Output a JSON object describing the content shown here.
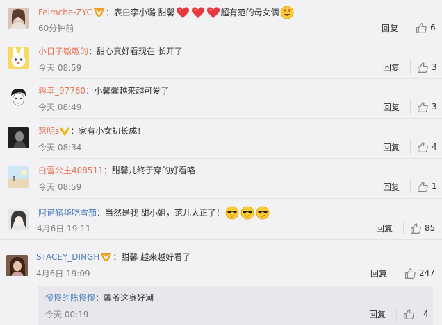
{
  "comments": [
    {
      "user": "Feimche-ZYC",
      "text_parts": [
        "：表白李小璐 甜馨",
        "超有范的母女俩"
      ],
      "time": "60分钟前",
      "reply": "回复",
      "likes": "6",
      "avatar": "avatar-photo-girl"
    },
    {
      "user": "小日子嗷嗷的",
      "text_parts": [
        "：甜心真好看现在 长开了"
      ],
      "time": "今天 08:59",
      "reply": "回复",
      "likes": "3",
      "avatar": "avatar-bunny-cartoon"
    },
    {
      "user": "蓉幸_97760",
      "text_parts": [
        "：小馨馨越来越可爱了"
      ],
      "time": "今天 08:49",
      "reply": "回复",
      "likes": "3",
      "avatar": "avatar-sketch-face"
    },
    {
      "user": "慧明s",
      "text_parts": [
        "：家有小女初长成！"
      ],
      "time": "今天 08:34",
      "reply": "回复",
      "likes": "4",
      "avatar": "avatar-dark-portrait"
    },
    {
      "user": "白雪公主408511",
      "text_parts": [
        "：甜馨儿终于穿的好看咯"
      ],
      "time": "今天 08:59",
      "reply": "回复",
      "likes": "1",
      "avatar": "avatar-landscape"
    },
    {
      "user": "阿诺猪华吃雪茄",
      "text_parts": [
        "：当然是我 甜小姐，范儿太正了！"
      ],
      "time": "4月6日 19:11",
      "reply": "回复",
      "likes": "85",
      "avatar": "avatar-anime-girl"
    },
    {
      "user": "STACEY_DINGH",
      "text_parts": [
        "：甜馨 越来越好看了"
      ],
      "time": "4月6日 19:09",
      "reply": "回复",
      "likes": "247",
      "avatar": "avatar-woman-photo"
    }
  ],
  "subreply": {
    "user": "慢慢的陈慢慢",
    "text": "：馨爷这身好潮",
    "time": "今天 00:19",
    "reply": "回复",
    "likes": "4"
  },
  "colors": {
    "orange_name": "#eb7350",
    "blue_name": "#4a7fbc",
    "heart": "#e8383d"
  }
}
